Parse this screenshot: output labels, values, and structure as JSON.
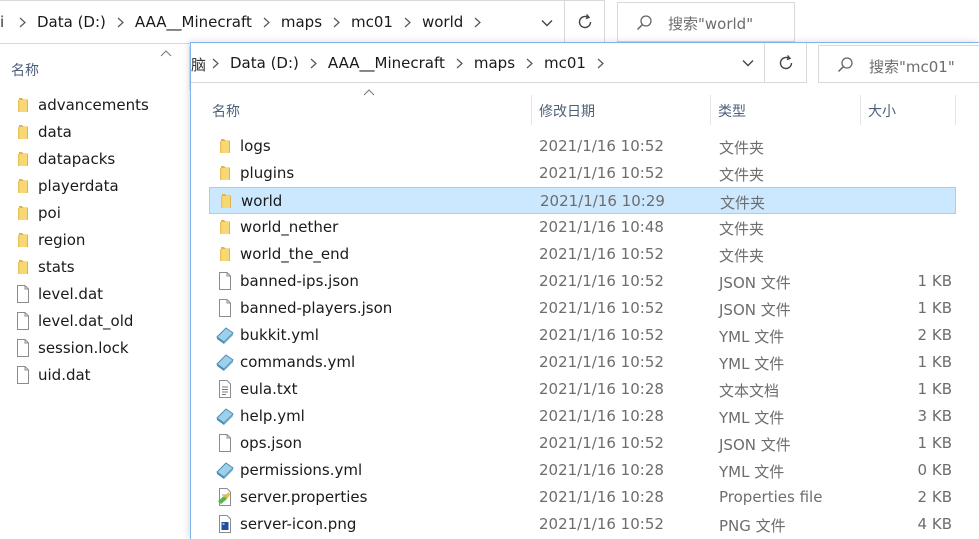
{
  "back_window": {
    "address": {
      "pc_fragment": "i",
      "crumbs": [
        "Data (D:)",
        "AAA__Minecraft",
        "maps",
        "mc01",
        "world"
      ]
    },
    "search_placeholder": "搜索\"world\"",
    "column_header": "名称",
    "items": [
      {
        "name": "advancements",
        "icon": "folder-icon"
      },
      {
        "name": "data",
        "icon": "folder-icon"
      },
      {
        "name": "datapacks",
        "icon": "folder-icon"
      },
      {
        "name": "playerdata",
        "icon": "folder-icon"
      },
      {
        "name": "poi",
        "icon": "folder-icon"
      },
      {
        "name": "region",
        "icon": "folder-icon"
      },
      {
        "name": "stats",
        "icon": "folder-icon"
      },
      {
        "name": "level.dat",
        "icon": "file-icon"
      },
      {
        "name": "level.dat_old",
        "icon": "file-icon"
      },
      {
        "name": "session.lock",
        "icon": "file-icon"
      },
      {
        "name": "uid.dat",
        "icon": "file-icon"
      }
    ]
  },
  "front_window": {
    "address": {
      "pc_fragment": "脑",
      "crumbs": [
        "Data (D:)",
        "AAA__Minecraft",
        "maps",
        "mc01"
      ]
    },
    "search_placeholder": "搜索\"mc01\"",
    "columns": {
      "name": "名称",
      "date": "修改日期",
      "type": "类型",
      "size": "大小"
    },
    "files": [
      {
        "name": "logs",
        "date": "2021/1/16 10:52",
        "type": "文件夹",
        "size": "",
        "icon": "folder-icon"
      },
      {
        "name": "plugins",
        "date": "2021/1/16 10:52",
        "type": "文件夹",
        "size": "",
        "icon": "folder-icon"
      },
      {
        "name": "world",
        "date": "2021/1/16 10:29",
        "type": "文件夹",
        "size": "",
        "icon": "folder-icon",
        "selected": true
      },
      {
        "name": "world_nether",
        "date": "2021/1/16 10:48",
        "type": "文件夹",
        "size": "",
        "icon": "folder-icon"
      },
      {
        "name": "world_the_end",
        "date": "2021/1/16 10:52",
        "type": "文件夹",
        "size": "",
        "icon": "folder-icon"
      },
      {
        "name": "banned-ips.json",
        "date": "2021/1/16 10:52",
        "type": "JSON 文件",
        "size": "1 KB",
        "icon": "json-file-icon"
      },
      {
        "name": "banned-players.json",
        "date": "2021/1/16 10:52",
        "type": "JSON 文件",
        "size": "1 KB",
        "icon": "json-file-icon"
      },
      {
        "name": "bukkit.yml",
        "date": "2021/1/16 10:52",
        "type": "YML 文件",
        "size": "2 KB",
        "icon": "yml-file-icon"
      },
      {
        "name": "commands.yml",
        "date": "2021/1/16 10:52",
        "type": "YML 文件",
        "size": "1 KB",
        "icon": "yml-file-icon"
      },
      {
        "name": "eula.txt",
        "date": "2021/1/16 10:28",
        "type": "文本文档",
        "size": "1 KB",
        "icon": "text-file-icon"
      },
      {
        "name": "help.yml",
        "date": "2021/1/16 10:28",
        "type": "YML 文件",
        "size": "3 KB",
        "icon": "yml-file-icon"
      },
      {
        "name": "ops.json",
        "date": "2021/1/16 10:52",
        "type": "JSON 文件",
        "size": "1 KB",
        "icon": "json-file-icon"
      },
      {
        "name": "permissions.yml",
        "date": "2021/1/16 10:28",
        "type": "YML 文件",
        "size": "0 KB",
        "icon": "yml-file-icon"
      },
      {
        "name": "server.properties",
        "date": "2021/1/16 10:28",
        "type": "Properties file",
        "size": "2 KB",
        "icon": "properties-file-icon"
      },
      {
        "name": "server-icon.png",
        "date": "2021/1/16 10:52",
        "type": "PNG 文件",
        "size": "4 KB",
        "icon": "image-file-icon"
      }
    ]
  },
  "colors": {
    "selection_bg": "#cce8ff",
    "selection_border": "#99d1ff",
    "folder_yellow": "#f8d775",
    "header_text": "#4c607a",
    "window_border": "#7eb4ea"
  }
}
